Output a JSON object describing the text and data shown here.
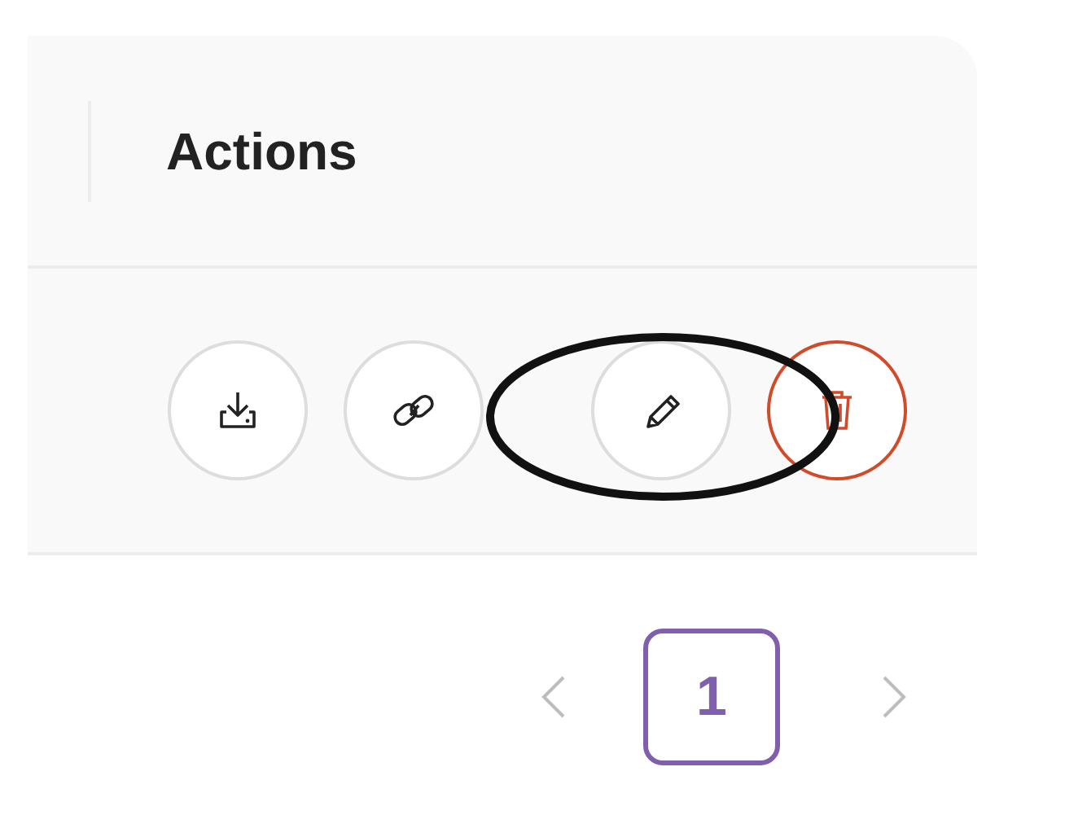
{
  "table": {
    "header": "Actions",
    "row_actions": [
      {
        "kind": "download"
      },
      {
        "kind": "link"
      },
      {
        "kind": "edit",
        "circled": true
      },
      {
        "kind": "delete"
      }
    ]
  },
  "pagination": {
    "pages": [
      {
        "label": "1",
        "selected": true
      }
    ]
  }
}
